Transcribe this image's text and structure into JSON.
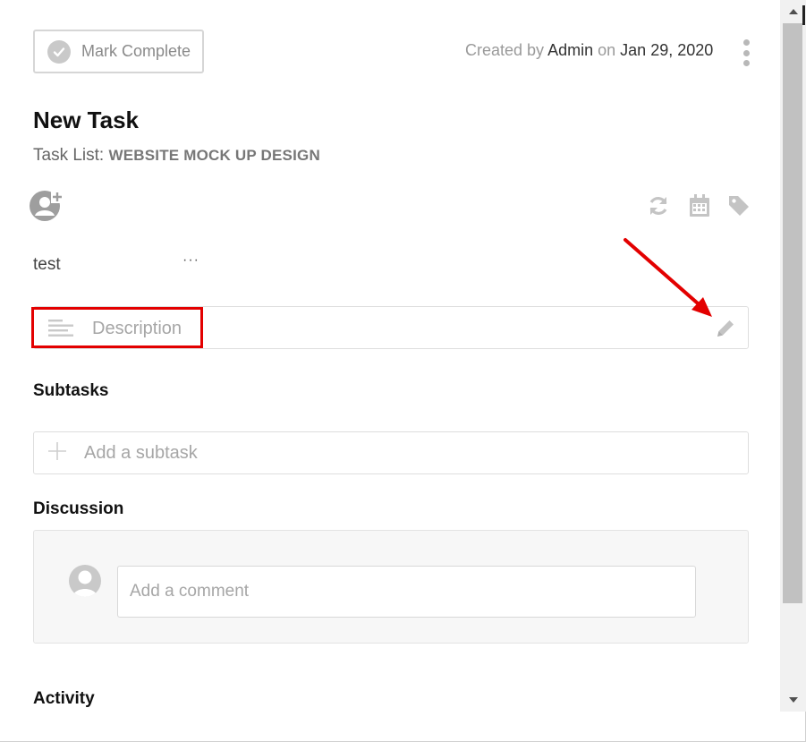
{
  "header": {
    "mark_complete_label": "Mark Complete",
    "created_prefix": "Created by",
    "created_by": "Admin",
    "created_on_word": "on",
    "created_date": "Jan 29, 2020"
  },
  "task": {
    "title": "New Task",
    "task_list_prefix": "Task List:",
    "task_list_name": "WEBSITE MOCK UP DESIGN",
    "custom_field_value": "test",
    "custom_field_more": "···"
  },
  "description": {
    "placeholder": "Description"
  },
  "subtasks": {
    "heading": "Subtasks",
    "placeholder": "Add a subtask"
  },
  "discussion": {
    "heading": "Discussion",
    "placeholder": "Add a comment"
  },
  "activity": {
    "heading": "Activity"
  },
  "colors": {
    "annotation_red": "#e30000",
    "icon_gray": "#c4c4c4"
  },
  "icons": [
    "check-circle-icon",
    "kebab-menu-icon",
    "add-user-icon",
    "refresh-icon",
    "calendar-icon",
    "tag-icon",
    "align-left-icon",
    "pencil-icon",
    "plus-icon",
    "user-avatar-icon"
  ]
}
